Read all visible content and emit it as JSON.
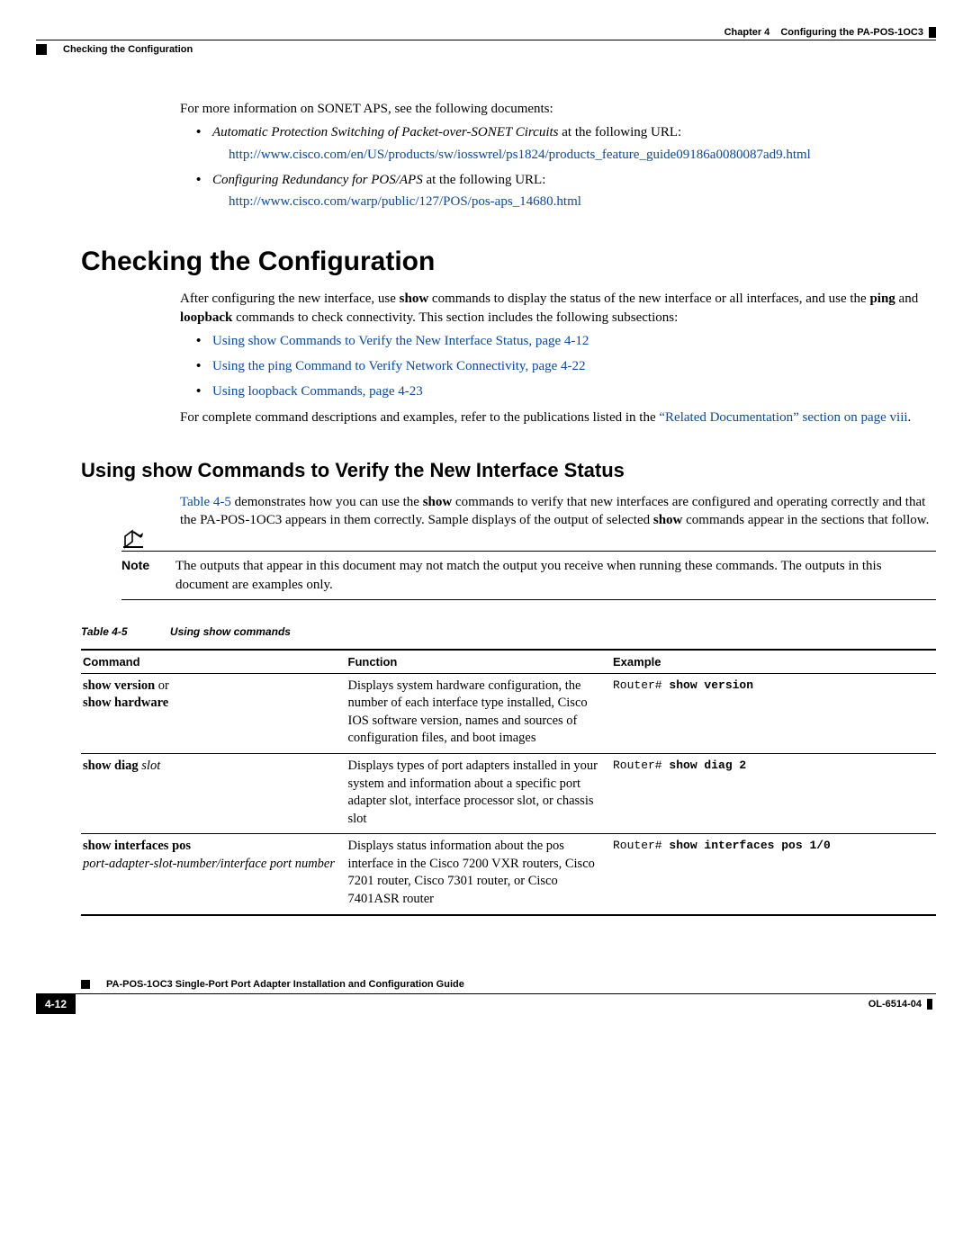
{
  "header": {
    "chapter_label": "Chapter 4",
    "chapter_title": "Configuring the PA-POS-1OC3",
    "section_title": "Checking the Configuration"
  },
  "intro": {
    "para1": "For more information on SONET APS, see the following documents:",
    "bullet1_italic": "Automatic Protection Switching of Packet-over-SONET Circuits",
    "bullet1_tail": " at the following URL:",
    "bullet1_url": "http://www.cisco.com/en/US/products/sw/iosswrel/ps1824/products_feature_guide09186a0080087ad9.html",
    "bullet2_italic": "Configuring Redundancy for POS/APS",
    "bullet2_tail": " at the following URL:",
    "bullet2_url": "http://www.cisco.com/warp/public/127/POS/pos-aps_14680.html"
  },
  "h1": "Checking the Configuration",
  "checking": {
    "para_pre": "After configuring the new interface, use ",
    "show_bold": "show",
    "para_mid1": " commands to display the status of the new interface or all interfaces, and use the ",
    "ping_bold": "ping",
    "para_mid2": " and ",
    "loopback_bold": "loopback",
    "para_mid3": " commands to check connectivity. This section includes the following subsections:",
    "link1": "Using show Commands to Verify the New Interface Status, page 4-12",
    "link2": "Using the ping Command to Verify Network Connectivity, page 4-22",
    "link3": "Using loopback Commands, page 4-23",
    "para2_pre": "For complete command descriptions and examples, refer to the publications listed in the ",
    "para2_link": "“Related Documentation” section on page viii",
    "para2_post": "."
  },
  "h2": "Using show Commands to Verify the New Interface Status",
  "h2body": {
    "tref": "Table 4-5",
    "p_mid1": " demonstrates how you can use the ",
    "show_bold": "show",
    "p_mid2": " commands to verify that new interfaces are configured and operating correctly and that the PA-POS-1OC3 appears in them correctly. Sample displays of the output of selected ",
    "show_bold2": "show",
    "p_mid3": " commands appear in the sections that follow."
  },
  "note": {
    "label": "Note",
    "text": "The outputs that appear in this document may not match the output you receive when running these commands. The outputs in this document are examples only."
  },
  "table": {
    "caption_num": "Table 4-5",
    "caption_text": "Using show commands",
    "headers": {
      "c1": "Command",
      "c2": "Function",
      "c3": "Example"
    },
    "rows": [
      {
        "cmd_bold1": "show version",
        "cmd_join": " or",
        "cmd_bold2": "show hardware",
        "func": "Displays system hardware configuration, the number of each interface type installed, Cisco IOS software version, names and sources of configuration files, and boot images",
        "ex_prompt": "Router# ",
        "ex_cmd": "show version"
      },
      {
        "cmd_bold1": "show diag",
        "cmd_italic": " slot",
        "func": "Displays types of port adapters installed in your system and information about a specific port adapter slot, interface processor slot, or chassis slot",
        "ex_prompt": "Router# ",
        "ex_cmd": "show diag 2"
      },
      {
        "cmd_bold1": "show interfaces pos",
        "cmd_italic_line": "port-adapter-slot-number/interface port number",
        "func": "Displays status information about the pos interface in the Cisco 7200 VXR routers, Cisco 7201 router, Cisco 7301 router, or Cisco 7401ASR router",
        "ex_prompt": "Router# ",
        "ex_cmd": "show interfaces pos 1/0"
      }
    ]
  },
  "footer": {
    "guide_title": "PA-POS-1OC3 Single-Port Port Adapter Installation and Configuration Guide",
    "page": "4-12",
    "docid": "OL-6514-04"
  }
}
